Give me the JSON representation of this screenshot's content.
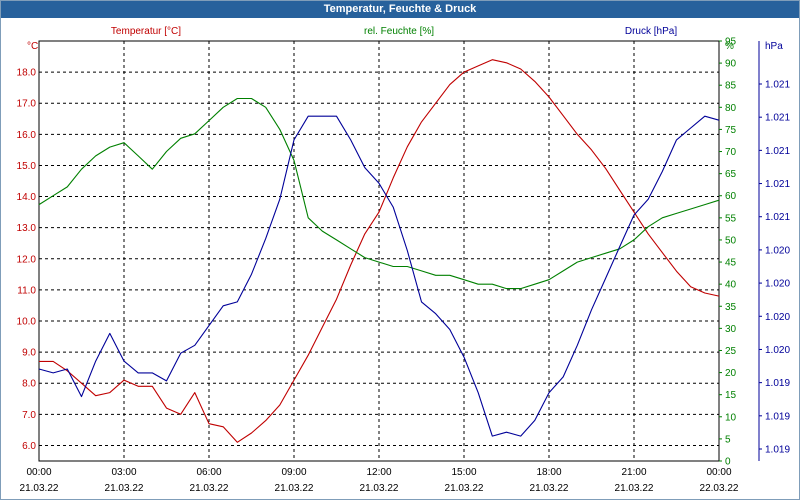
{
  "window": {
    "title": "Temperatur, Feuchte & Druck"
  },
  "chart_data": {
    "type": "line",
    "title": "Temperatur, Feuchte & Druck",
    "grid": true,
    "x_ticks": [
      {
        "time": "00:00",
        "date": "21.03.22"
      },
      {
        "time": "03:00",
        "date": "21.03.22"
      },
      {
        "time": "06:00",
        "date": "21.03.22"
      },
      {
        "time": "09:00",
        "date": "21.03.22"
      },
      {
        "time": "12:00",
        "date": "21.03.22"
      },
      {
        "time": "15:00",
        "date": "21.03.22"
      },
      {
        "time": "18:00",
        "date": "21.03.22"
      },
      {
        "time": "21:00",
        "date": "21.03.22"
      },
      {
        "time": "00:00",
        "date": "22.03.22"
      }
    ],
    "xlim_hours": [
      0,
      24
    ],
    "axes": {
      "temperature": {
        "label": "Temperatur [°C]",
        "unit": "°C",
        "color": "#c00000",
        "ylim": [
          5.5,
          19.0
        ],
        "ticks": [
          "6.0",
          "7.0",
          "8.0",
          "9.0",
          "10.0",
          "11.0",
          "12.0",
          "13.0",
          "14.0",
          "15.0",
          "16.0",
          "17.0",
          "18.0"
        ]
      },
      "humidity": {
        "label": "rel. Feuchte [%]",
        "unit": "%",
        "color": "#008000",
        "ylim": [
          0,
          95
        ],
        "ticks": [
          "0",
          "5",
          "10",
          "15",
          "20",
          "25",
          "30",
          "35",
          "40",
          "45",
          "50",
          "55",
          "60",
          "65",
          "70",
          "75",
          "80",
          "85",
          "90",
          "95"
        ]
      },
      "pressure": {
        "label": "Druck [hPa]",
        "unit": "hPa",
        "color": "#000099",
        "ticks": [
          "1.019",
          "1.019",
          "1.019",
          "1.020",
          "1.020",
          "1.020",
          "1.020",
          "1.021",
          "1.021",
          "1.021",
          "1.021",
          "1.021"
        ]
      }
    },
    "series": [
      {
        "name": "Temperatur [°C]",
        "axis": "temperature",
        "color": "#c00000",
        "x": [
          0,
          0.5,
          1,
          1.5,
          2,
          2.5,
          3,
          3.5,
          4,
          4.5,
          5,
          5.5,
          6,
          6.5,
          7,
          7.5,
          8,
          8.5,
          9,
          9.5,
          10,
          10.5,
          11,
          11.5,
          12,
          12.5,
          13,
          13.5,
          14,
          14.5,
          15,
          15.5,
          16,
          16.5,
          17,
          17.5,
          18,
          18.5,
          19,
          19.5,
          20,
          20.5,
          21,
          21.5,
          22,
          22.5,
          23,
          23.5,
          24
        ],
        "values": [
          8.7,
          8.7,
          8.4,
          8.0,
          7.6,
          7.7,
          8.1,
          7.9,
          7.9,
          7.2,
          7.0,
          7.7,
          6.7,
          6.6,
          6.1,
          6.4,
          6.8,
          7.3,
          8.1,
          8.9,
          9.8,
          10.7,
          11.8,
          12.8,
          13.5,
          14.6,
          15.6,
          16.4,
          17.0,
          17.6,
          18.0,
          18.2,
          18.4,
          18.3,
          18.1,
          17.7,
          17.2,
          16.6,
          16.0,
          15.5,
          14.9,
          14.2,
          13.5,
          12.8,
          12.2,
          11.6,
          11.1,
          10.9,
          10.8
        ]
      },
      {
        "name": "rel. Feuchte [%]",
        "axis": "humidity",
        "color": "#008000",
        "x": [
          0,
          0.5,
          1,
          1.5,
          2,
          2.5,
          3,
          3.5,
          4,
          4.5,
          5,
          5.5,
          6,
          6.5,
          7,
          7.5,
          8,
          8.5,
          9,
          9.5,
          10,
          10.5,
          11,
          11.5,
          12,
          12.5,
          13,
          13.5,
          14,
          14.5,
          15,
          15.5,
          16,
          16.5,
          17,
          17.5,
          18,
          18.5,
          19,
          19.5,
          20,
          20.5,
          21,
          21.5,
          22,
          22.5,
          23,
          23.5,
          24
        ],
        "values": [
          58,
          60,
          62,
          66,
          69,
          71,
          72,
          69,
          66,
          70,
          73,
          74,
          77,
          80,
          82,
          82,
          80,
          75,
          68,
          55,
          52,
          50,
          48,
          46,
          45,
          44,
          44,
          43,
          42,
          42,
          41,
          40,
          40,
          39,
          39,
          40,
          41,
          43,
          45,
          46,
          47,
          48,
          50,
          53,
          55,
          56,
          57,
          58,
          59
        ]
      },
      {
        "name": "Druck [hPa]",
        "axis": "pressure",
        "color": "#000099",
        "note_scale": "relative",
        "x": [
          0,
          0.5,
          1,
          1.5,
          2,
          2.5,
          3,
          3.5,
          4,
          4.5,
          5,
          5.5,
          6,
          6.5,
          7,
          7.5,
          8,
          8.5,
          9,
          9.5,
          10,
          10.5,
          11,
          11.5,
          12,
          12.5,
          13,
          13.5,
          14,
          14.5,
          15,
          15.5,
          16,
          16.5,
          17,
          17.5,
          18,
          18.5,
          19,
          19.5,
          20,
          20.5,
          21,
          21.5,
          22,
          22.5,
          23,
          23.5,
          24
        ],
        "values": [
          20,
          19,
          20,
          13,
          22,
          29,
          22,
          19,
          19,
          17,
          24,
          26,
          31,
          36,
          37,
          44,
          53,
          63,
          78,
          84,
          84,
          84,
          78,
          71,
          67,
          61,
          50,
          37,
          34,
          30,
          23,
          14,
          3,
          4,
          3,
          7,
          14,
          18,
          26,
          35,
          43,
          51,
          59,
          63,
          70,
          78,
          81,
          84,
          83
        ]
      }
    ]
  }
}
